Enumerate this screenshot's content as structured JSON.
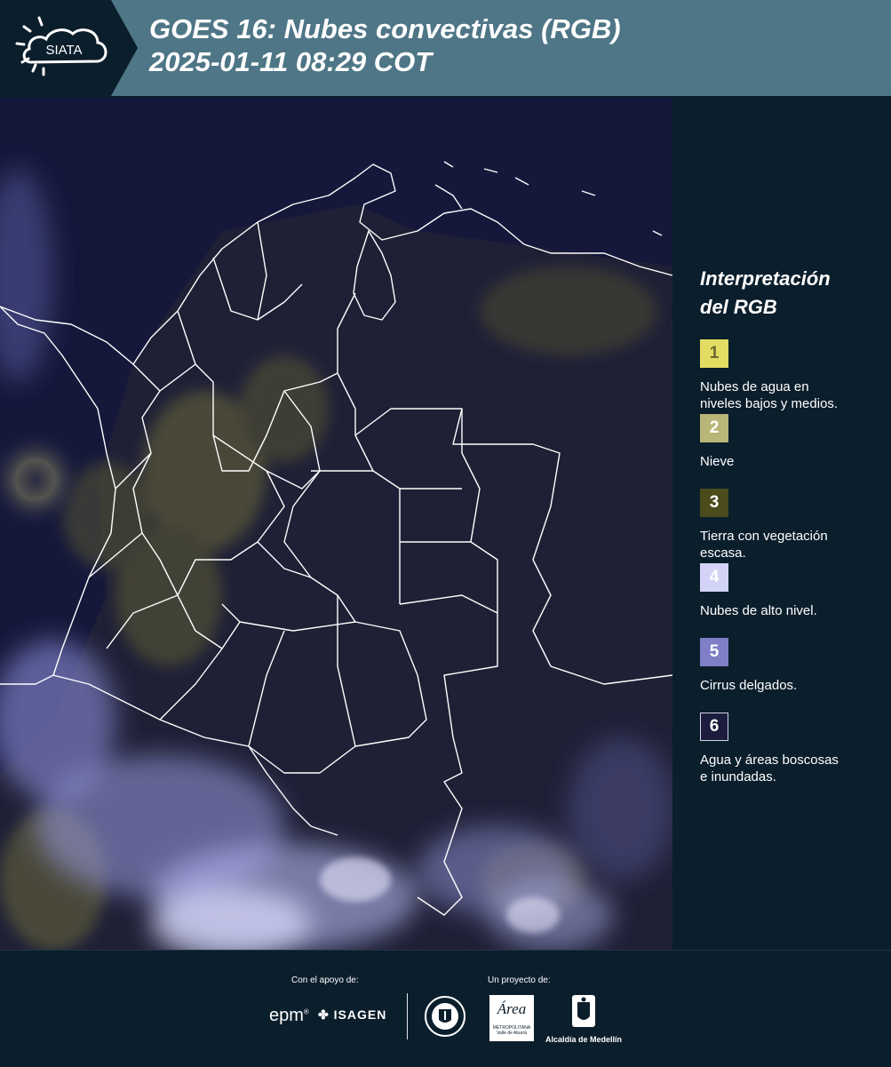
{
  "header": {
    "logo_text": "SIATA",
    "title_line1": "GOES 16: Nubes convectivas (RGB)",
    "title_line2": " 2025-01-11 08:29 COT"
  },
  "legend": {
    "title_line1": "Interpretación",
    "title_line2": "del RGB",
    "items": [
      {
        "number": "1",
        "label_line1": "Nubes de agua en",
        "label_line2": "niveles bajos y medios.",
        "color": "#e2dc62",
        "text_color": "#6b6830"
      },
      {
        "number": "2",
        "label_line1": "Nieve",
        "label_line2": "",
        "color": "#b9b677",
        "text_color": "#ffffff"
      },
      {
        "number": "3",
        "label_line1": "Tierra con vegetación",
        "label_line2": "escasa.",
        "color": "#4c4b1c",
        "text_color": "#ffffff"
      },
      {
        "number": "4",
        "label_line1": "Nubes de alto nivel.",
        "label_line2": "",
        "color": "#d2d3f6",
        "text_color": "#ffffff"
      },
      {
        "number": "5",
        "label_line1": "Cirrus delgados.",
        "label_line2": "",
        "color": "#7e7fc6",
        "text_color": "#ffffff"
      },
      {
        "number": "6",
        "label_line1": "Agua y áreas boscosas",
        "label_line2": "e inundadas.",
        "color": "#1b1c3e",
        "text_color": "#ffffff"
      }
    ]
  },
  "footer": {
    "support_label": "Con el apoyo de:",
    "project_label": "Un proyecto de:",
    "sponsor_epm": "epm",
    "sponsor_isagen": "ISAGEN",
    "area_name": "Área",
    "area_subtitle": "METROPOLITANA",
    "area_subtitle2": "Valle de Aburrá",
    "alcaldia": "Alcaldía de Medellín",
    "medellin_seal": "MEDELLÍN"
  },
  "colors": {
    "header_bg": "#4e7686",
    "logo_bg": "#0b1e2c",
    "page_bg": "#0b1e2c",
    "map_water": "#14183a",
    "border_line": "#ffffff"
  }
}
